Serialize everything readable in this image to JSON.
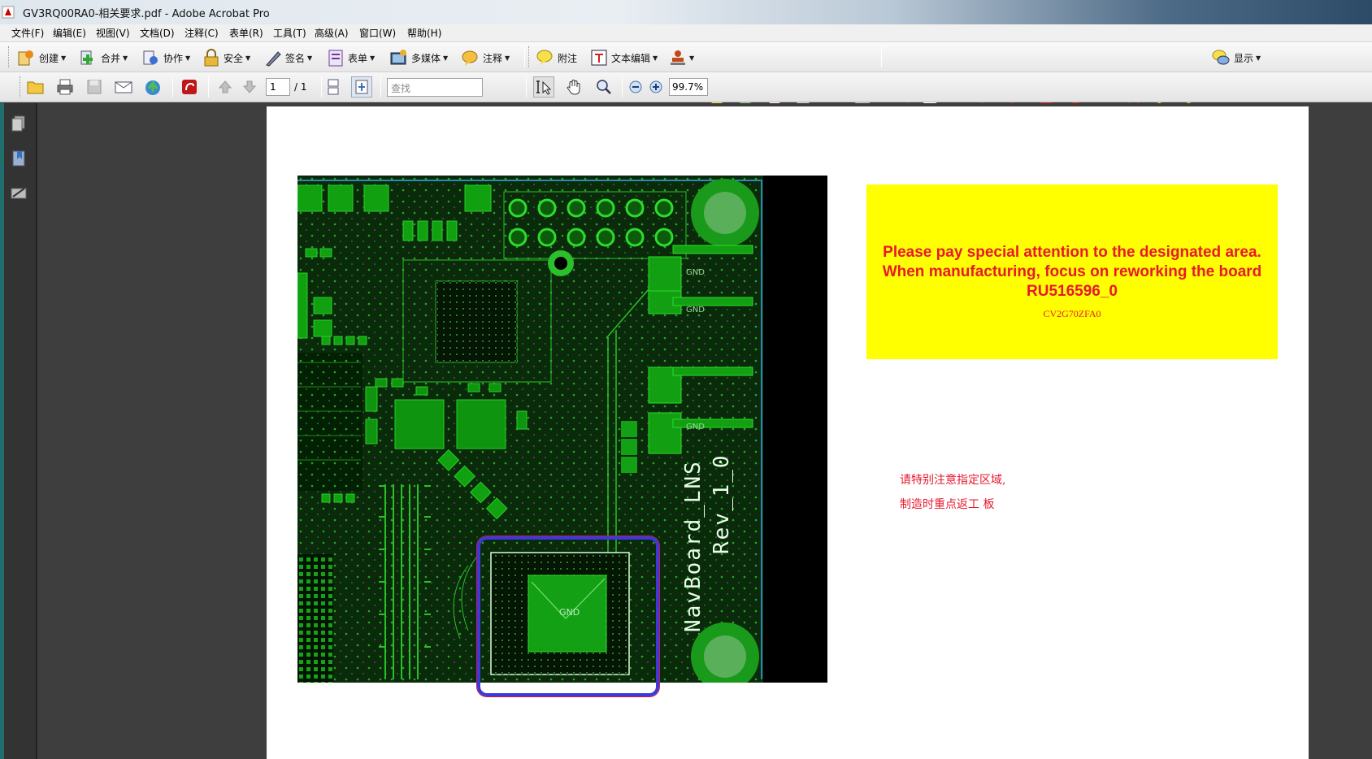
{
  "window": {
    "title": "GV3RQ00RA0-相关要求.pdf - Adobe Acrobat Pro"
  },
  "menu": [
    "文件(F)",
    "编辑(E)",
    "视图(V)",
    "文档(D)",
    "注释(C)",
    "表单(R)",
    "工具(T)",
    "高级(A)",
    "窗口(W)",
    "帮助(H)"
  ],
  "toolbar1": {
    "create": "创建",
    "combine": "合并",
    "collaborate": "协作",
    "secure": "安全",
    "sign": "签名",
    "forms": "表单",
    "multimedia": "多媒体",
    "comment": "注释",
    "attach": "附注",
    "text_edit": "文本编辑",
    "show": "显示"
  },
  "toolbar2": {
    "page_current": "1",
    "page_total": "/ 1",
    "find_placeholder": "查找",
    "zoom": "99.7%"
  },
  "document": {
    "notice_en": [
      "Please pay special attention to the designated area.",
      "When manufacturing, focus on reworking the board",
      "RU516596_0"
    ],
    "notice_code": "CV2G70ZFA0",
    "notice_cn": [
      "请特别注意指定区域,",
      "制造时重点返工 板"
    ]
  },
  "pcb": {
    "board_name": "NavBoard_LNS",
    "board_rev": "Rev_1_0",
    "labels": [
      "GND",
      "GND",
      "GND",
      "GND"
    ]
  },
  "colors": {
    "notice_bg": "#ffff00",
    "notice_text": "#e8192c",
    "pcb_bg": "#0b2a0b",
    "copper": "#0fa00f",
    "highlight": "#3a3adc"
  }
}
